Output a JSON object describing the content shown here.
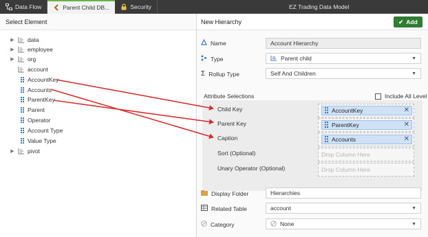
{
  "tabs": [
    {
      "label": "Data Flow",
      "icon": "data-flow-icon"
    },
    {
      "label": "Parent Child DB...",
      "icon": "back-arrow-icon"
    },
    {
      "label": "Security",
      "icon": "lock-icon"
    }
  ],
  "model_title": "EZ Trading Data Model",
  "left": {
    "title": "Select Element",
    "tree": [
      {
        "label": "data",
        "type": "hierarchy",
        "expandable": true
      },
      {
        "label": "employee",
        "type": "hierarchy",
        "expandable": true
      },
      {
        "label": "org",
        "type": "hierarchy",
        "expandable": true
      },
      {
        "label": "account",
        "type": "hierarchy",
        "expandable": false
      },
      {
        "label": "AccountKey",
        "type": "column"
      },
      {
        "label": "Accounts",
        "type": "column"
      },
      {
        "label": "ParentKey",
        "type": "column"
      },
      {
        "label": "Parent",
        "type": "column"
      },
      {
        "label": "Operator",
        "type": "column"
      },
      {
        "label": "Account Type",
        "type": "column"
      },
      {
        "label": "Value Type",
        "type": "column"
      },
      {
        "label": "pivot",
        "type": "hierarchy",
        "expandable": true
      }
    ]
  },
  "right": {
    "title": "New Hierarchy",
    "add_label": "Add",
    "name_label": "Name",
    "name_value": "Account Hierarchy",
    "type_label": "Type",
    "type_value": "Parent child",
    "rollup_label": "Rollup Type",
    "rollup_value": "Self And Children",
    "attr_section_label": "Attribute Selections",
    "include_all_label": "Include All Level",
    "attributes": [
      {
        "label": "Child Key",
        "value": "AccountKey"
      },
      {
        "label": "Parent Key",
        "value": "ParentKey"
      },
      {
        "label": "Caption",
        "value": "Accounts"
      },
      {
        "label": "Sort (Optional)",
        "value": ""
      },
      {
        "label": "Unary Operator (Optional)",
        "value": ""
      }
    ],
    "drop_placeholder": "Drop Column Here",
    "folder_label": "Display Folder",
    "folder_value": "Hierarchies",
    "related_label": "Related Table",
    "related_value": "account",
    "category_label": "Category",
    "category_value": "None"
  },
  "colors": {
    "accent_green": "#2e7d32",
    "arrow_red": "#d32f2f",
    "chip_blue": "#cfe2f5"
  }
}
